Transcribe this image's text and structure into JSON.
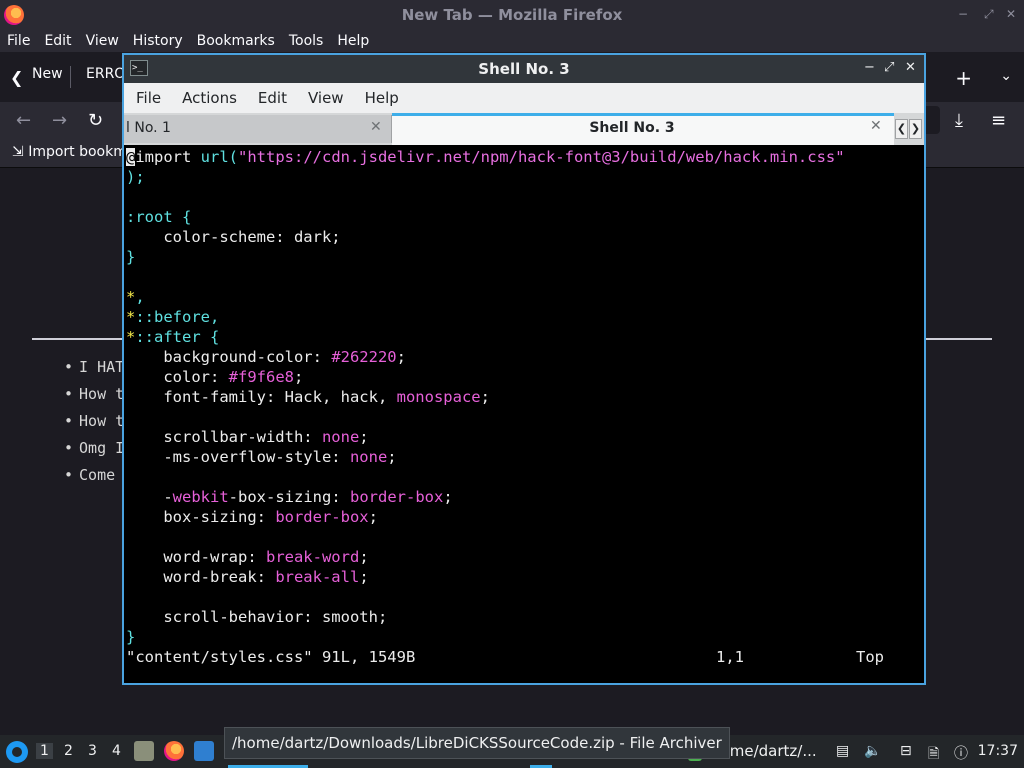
{
  "firefox": {
    "title": "New Tab — Mozilla Firefox",
    "menu": [
      "File",
      "Edit",
      "View",
      "History",
      "Bookmarks",
      "Tools",
      "Help"
    ],
    "tabs": [
      "New",
      "ERRO"
    ],
    "new_tab_symbol": "+",
    "bookmarks_import": "Import bookm",
    "list_items": [
      "I HAT",
      "How t",
      "How t",
      "Omg I",
      "Come"
    ]
  },
  "terminal": {
    "title": "Shell No. 3",
    "menu": [
      "File",
      "Actions",
      "Edit",
      "View",
      "Help"
    ],
    "tabs": [
      {
        "label": "l No. 1",
        "active": false
      },
      {
        "label": "Shell No. 3",
        "active": true
      }
    ],
    "lines": [
      "@import url(\"https://cdn.jsdelivr.net/npm/hack-font@3/build/web/hack.min.css\"",
      ");",
      "",
      ":root {",
      "    color-scheme: dark;",
      "}",
      "",
      "*,",
      "*::before,",
      "*::after {",
      "    background-color: #262220;",
      "    color: #f9f6e8;",
      "    font-family: Hack, hack, monospace;",
      "",
      "    scrollbar-width: none;",
      "    -ms-overflow-style: none;",
      "",
      "    -webkit-box-sizing: border-box;",
      "    box-sizing: border-box;",
      "",
      "    word-wrap: break-word;",
      "    word-break: break-all;",
      "",
      "    scroll-behavior: smooth;",
      "}"
    ],
    "status": {
      "file": "\"content/styles.css\" 91L, 1549B",
      "position": "1,1",
      "scroll": "Top"
    }
  },
  "taskbar": {
    "desktops": [
      "1",
      "2",
      "3",
      "4"
    ],
    "active_desktop": "1",
    "tasks": [
      "/home/dartz/..."
    ],
    "tooltip": "/home/dartz/Downloads/LibreDiCKSSourceCode.zip - File Archiver",
    "clock": "17:37"
  },
  "colors": {
    "accent": "#3daee9",
    "string": "#e76fe0",
    "selector": "#5fe0e0",
    "universal": "#f5e94a"
  }
}
